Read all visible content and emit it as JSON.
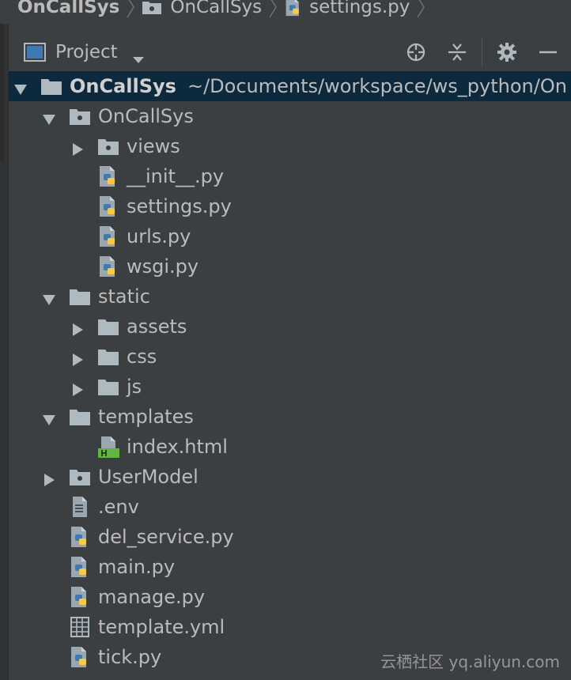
{
  "breadcrumb": {
    "items": [
      "OnCallSys",
      "OnCallSys",
      "settings.py"
    ]
  },
  "project_panel": {
    "title": "Project"
  },
  "tree": {
    "root_name": "OnCallSys",
    "root_path": "~/Documents/workspace/ws_python/On",
    "items": [
      {
        "label": "OnCallSys"
      },
      {
        "label": "views"
      },
      {
        "label": "__init__.py"
      },
      {
        "label": "settings.py"
      },
      {
        "label": "urls.py"
      },
      {
        "label": "wsgi.py"
      },
      {
        "label": "static"
      },
      {
        "label": "assets"
      },
      {
        "label": "css"
      },
      {
        "label": "js"
      },
      {
        "label": "templates"
      },
      {
        "label": "index.html"
      },
      {
        "label": "UserModel"
      },
      {
        "label": ".env"
      },
      {
        "label": "del_service.py"
      },
      {
        "label": "main.py"
      },
      {
        "label": "manage.py"
      },
      {
        "label": "template.yml"
      },
      {
        "label": "tick.py"
      }
    ]
  },
  "watermark": "云栖社区 yq.aliyun.com",
  "colors": {
    "background": "#3c3f41",
    "selection": "#0d293e",
    "text": "#bbbbbb",
    "folder": "#aeb9c0",
    "python_blue": "#3d7ab3",
    "python_yellow": "#f7c948",
    "html_green": "#62b543"
  }
}
